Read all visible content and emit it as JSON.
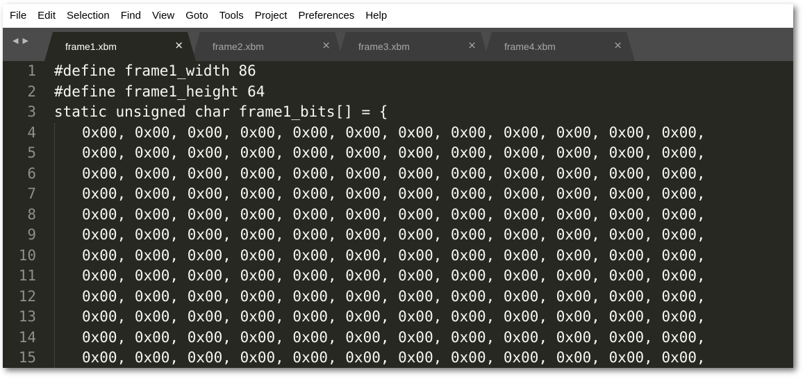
{
  "menu": {
    "items": [
      "File",
      "Edit",
      "Selection",
      "Find",
      "View",
      "Goto",
      "Tools",
      "Project",
      "Preferences",
      "Help"
    ]
  },
  "tabs": {
    "nav_left": "◀",
    "nav_right": "▶",
    "close_glyph": "×",
    "items": [
      {
        "label": "frame1.xbm",
        "active": true
      },
      {
        "label": "frame2.xbm",
        "active": false
      },
      {
        "label": "frame3.xbm",
        "active": false
      },
      {
        "label": "frame4.xbm",
        "active": false
      }
    ]
  },
  "editor": {
    "lines": [
      {
        "number": "1",
        "text": "#define frame1_width 86",
        "indent": false
      },
      {
        "number": "2",
        "text": "#define frame1_height 64",
        "indent": false
      },
      {
        "number": "3",
        "text": "static unsigned char frame1_bits[] = {",
        "indent": false
      },
      {
        "number": "4",
        "text": "0x00, 0x00, 0x00, 0x00, 0x00, 0x00, 0x00, 0x00, 0x00, 0x00, 0x00, 0x00,",
        "indent": true
      },
      {
        "number": "5",
        "text": "0x00, 0x00, 0x00, 0x00, 0x00, 0x00, 0x00, 0x00, 0x00, 0x00, 0x00, 0x00,",
        "indent": true
      },
      {
        "number": "6",
        "text": "0x00, 0x00, 0x00, 0x00, 0x00, 0x00, 0x00, 0x00, 0x00, 0x00, 0x00, 0x00,",
        "indent": true
      },
      {
        "number": "7",
        "text": "0x00, 0x00, 0x00, 0x00, 0x00, 0x00, 0x00, 0x00, 0x00, 0x00, 0x00, 0x00,",
        "indent": true
      },
      {
        "number": "8",
        "text": "0x00, 0x00, 0x00, 0x00, 0x00, 0x00, 0x00, 0x00, 0x00, 0x00, 0x00, 0x00,",
        "indent": true
      },
      {
        "number": "9",
        "text": "0x00, 0x00, 0x00, 0x00, 0x00, 0x00, 0x00, 0x00, 0x00, 0x00, 0x00, 0x00,",
        "indent": true
      },
      {
        "number": "10",
        "text": "0x00, 0x00, 0x00, 0x00, 0x00, 0x00, 0x00, 0x00, 0x00, 0x00, 0x00, 0x00,",
        "indent": true
      },
      {
        "number": "11",
        "text": "0x00, 0x00, 0x00, 0x00, 0x00, 0x00, 0x00, 0x00, 0x00, 0x00, 0x00, 0x00,",
        "indent": true
      },
      {
        "number": "12",
        "text": "0x00, 0x00, 0x00, 0x00, 0x00, 0x00, 0x00, 0x00, 0x00, 0x00, 0x00, 0x00,",
        "indent": true
      },
      {
        "number": "13",
        "text": "0x00, 0x00, 0x00, 0x00, 0x00, 0x00, 0x00, 0x00, 0x00, 0x00, 0x00, 0x00,",
        "indent": true
      },
      {
        "number": "14",
        "text": "0x00, 0x00, 0x00, 0x00, 0x00, 0x00, 0x00, 0x00, 0x00, 0x00, 0x00, 0x00,",
        "indent": true
      },
      {
        "number": "15",
        "text": "0x00, 0x00, 0x00, 0x00, 0x00, 0x00, 0x00, 0x00, 0x00, 0x00, 0x00, 0x00,",
        "indent": true
      }
    ]
  },
  "colors": {
    "editor_background": "#272822",
    "tabbar_background": "#4b4b4b",
    "active_tab": "#272822",
    "inactive_tab": "#3c3c3c",
    "code_text": "#f8f8f2",
    "line_numbers": "#8f908a"
  }
}
